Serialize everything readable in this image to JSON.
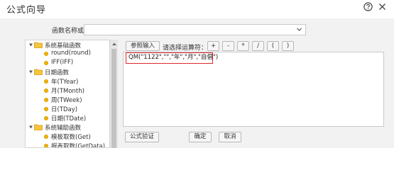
{
  "window": {
    "title": "公式向导"
  },
  "description": {
    "label": "函数名称或说明:",
    "value": ""
  },
  "tree": [
    {
      "kind": "folder",
      "label": "系统基础函数"
    },
    {
      "kind": "leaf",
      "label": "round(round)"
    },
    {
      "kind": "leaf",
      "label": "IFF(IFF)"
    },
    {
      "kind": "folder",
      "label": "日期函数"
    },
    {
      "kind": "leaf",
      "label": "年(TYear)"
    },
    {
      "kind": "leaf",
      "label": "月(TMonth)"
    },
    {
      "kind": "leaf",
      "label": "周(TWeek)"
    },
    {
      "kind": "leaf",
      "label": "日(TDay)"
    },
    {
      "kind": "leaf",
      "label": "日期(TDate)"
    },
    {
      "kind": "folder",
      "label": "系统辅助函数"
    },
    {
      "kind": "leaf",
      "label": "模板取数(Get)"
    },
    {
      "kind": "leaf",
      "label": "报表取数(GetData)"
    }
  ],
  "toolbar": {
    "param_input": "参照输入",
    "operator_label": "请选择运算符：",
    "operators": [
      "+",
      "-",
      "*",
      "/",
      "(",
      ")"
    ]
  },
  "editor": {
    "formula": "QM(\"1122\",\"\",\"年\",\"月\",\"自倡\")"
  },
  "footer": {
    "validate": "公式验证",
    "ok": "确定",
    "cancel": "取消"
  },
  "colors": {
    "highlight": "#e0262b",
    "folder": "#f0b400"
  }
}
